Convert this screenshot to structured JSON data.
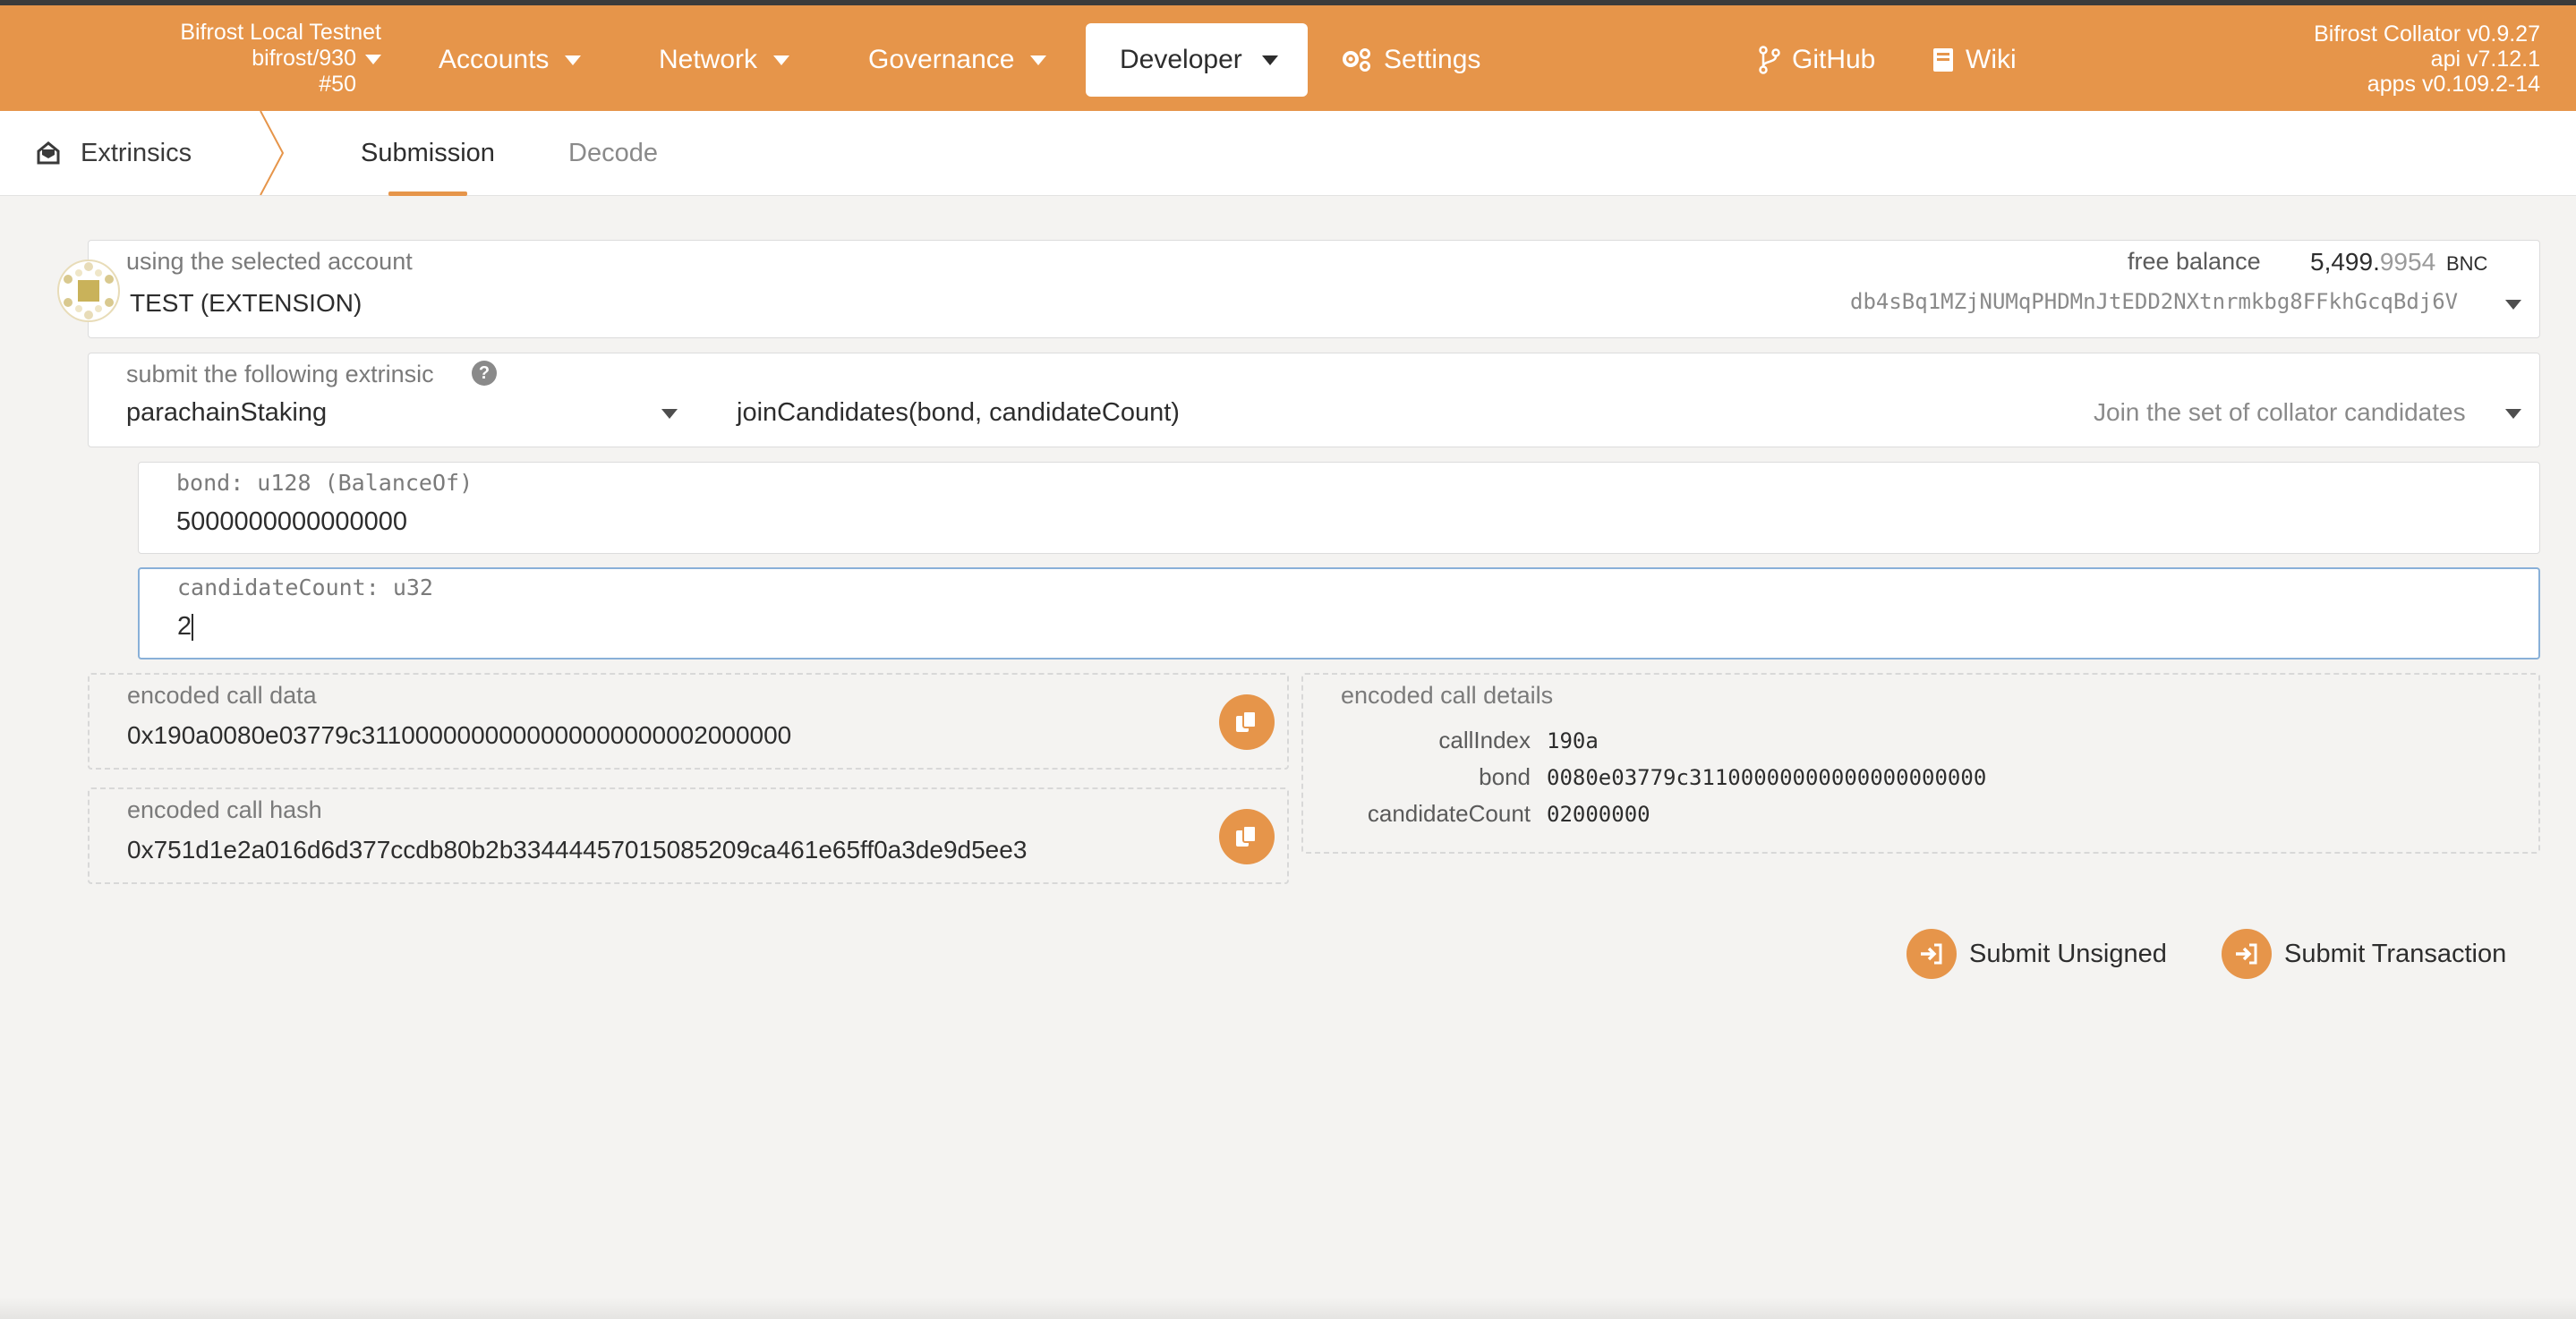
{
  "chain": {
    "name": "Bifrost Local Testnet",
    "path": "bifrost/930",
    "block": "#50"
  },
  "nav": {
    "accounts": "Accounts",
    "network": "Network",
    "governance": "Governance",
    "developer": "Developer",
    "settings": "Settings",
    "github": "GitHub",
    "wiki": "Wiki"
  },
  "version": {
    "collator": "Bifrost Collator v0.9.27",
    "api": "api v7.12.1",
    "apps": "apps v0.109.2-14"
  },
  "section": {
    "title": "Extrinsics",
    "tabs": [
      "Submission",
      "Decode"
    ]
  },
  "account": {
    "label": "using the selected account",
    "name": "TEST (EXTENSION)",
    "balance_label": "free balance",
    "balance_int": "5,499.",
    "balance_dec": "9954",
    "balance_unit": "BNC",
    "address": "db4sBq1MZjNUMqPHDMnJtEDD2NXtnrmkbg8FFkhGcqBdj6V"
  },
  "extrinsic": {
    "label": "submit the following extrinsic",
    "help": "?",
    "pallet": "parachainStaking",
    "call": "joinCandidates(bond, candidateCount)",
    "description": "Join the set of collator candidates"
  },
  "params": [
    {
      "label": "bond: u128 (BalanceOf)",
      "value": "5000000000000000"
    },
    {
      "label": "candidateCount: u32",
      "value": "2"
    }
  ],
  "encoded": {
    "call_data_label": "encoded call data",
    "call_data": "0x190a0080e03779c3110000000000000000000002000000",
    "call_hash_label": "encoded call hash",
    "call_hash": "0x751d1e2a016d6d377ccdb80b2b33444457015085209ca461e65ff0a3de9d5ee3",
    "details_label": "encoded call details",
    "details": [
      {
        "key": "callIndex",
        "value": "190a"
      },
      {
        "key": "bond",
        "value": "0080e03779c31100000000000000000000"
      },
      {
        "key": "candidateCount",
        "value": "02000000"
      }
    ]
  },
  "actions": {
    "submit_unsigned": "Submit Unsigned",
    "submit_transaction": "Submit Transaction"
  },
  "colors": {
    "accent": "#e6954a",
    "background": "#f4f3f1"
  }
}
